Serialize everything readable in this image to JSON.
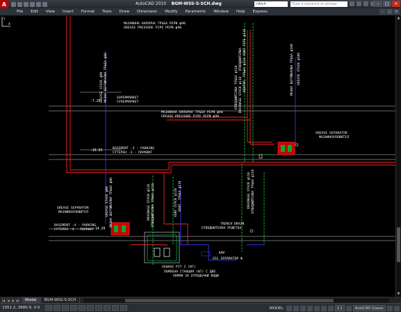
{
  "titlebar": {
    "app_letter": "A",
    "app_name": "AutoCAD 2010",
    "file_name": "BGM-WSS-S-SCH.dwg",
    "search_placeholder": "Type a keyword or phrase",
    "workspace_field": "r-Arch",
    "minimize": "–",
    "maximize": "□",
    "close": "×"
  },
  "menubar": {
    "items": [
      "File",
      "Edit",
      "View",
      "Insert",
      "Format",
      "Tools",
      "Draw",
      "Dimension",
      "Modify",
      "Parametric",
      "Window",
      "Help",
      "Express"
    ],
    "doc_minimize": "–",
    "doc_restore": "□",
    "doc_close": "×"
  },
  "drawing": {
    "labels": {
      "pipe_bg_top": "МАЗНИННА НАПОРНА ТРЪБА PEPN ф90",
      "pipe_en_top": "GREASE PRESSURE PIPE PEPN ф90",
      "pipe_bg_mid": "МАЗНИННА НАПОРНА ТРЪБА PEPN ф90",
      "pipe_en_mid": "GREASE PRESSURE PIPE PEPN ф90",
      "level_1": "-7.20",
      "supermarket_en": "SUPERMARKET",
      "supermarket_bg": "СУПЕРМАРКЕТ",
      "level_2": "-10.95",
      "basement3_en": "BASEMENT -3 - PARKING",
      "basement3_bg": "СУТЕРЕН -3 - ПАРКИНГ",
      "level_3": "-14.20",
      "basement4_en": "BASEMENT -4 - PARKING",
      "basement4_bg": "СУТЕРЕН -4 - ПАРКИНГ",
      "grease_sep_right_en": "GREASE SEPARATOR",
      "grease_sep_right_bg": "МАЗНИНОУЛОВИТЕЛ",
      "grease_sep_left_en": "GREASE SEPARATOR",
      "grease_sep_left_bg": "МАЗНИНОУЛОВИТЕЛ",
      "trench_en": "TRENCH DRAIN",
      "trench_bg": "ОТВОДНИТЕЛНА РЕШЕТКА",
      "kmv": "КМУ",
      "oil_sep": "OIL SEPARATOR №",
      "sewage_pit_en": "SEWAGE PIT 2 (N7)",
      "sewage_pit_bg1": "ПОМПЕНА СТАНЦИЯ (N7) С ДВЕ",
      "sewage_pit_bg2": "ПОМПИ ЗА ОТПАДЪЧНИ ВОДИ",
      "v_grease_stack_left_en": "GREASE STACK ф90",
      "v_grease_stack_left_bg": "МАЗНА ВЕРТИКАЛНА ТРЪБА ф90",
      "v_grease_stack_right_bg": "МАЗНА ВЕРТИКАЛНА ТРЪБА ф100",
      "v_grease_stack_right_en": "GREASE STACK ф100",
      "v_grease_stack_low_en": "GREASE STACK ф90",
      "v_grease_stack_low_bg": "МАЗНА ВЕРТИКАЛНА ТРЪБА ф90",
      "v_drainage_top1": "ОТВОДНИТЕЛНА ТРЪБА ф110",
      "v_drainage_top2": "DRAINAGE STACK ф110 - ОТВОДНИТЕЛНА",
      "v_drainage_top3": "ВЕНТИЛ. ТРЪБА ф110 VENT PIPE ф110",
      "v_drainage_mid1": "DRAINAGE STACK ф110",
      "v_drainage_mid2": "ОТВОДНИТЕЛНА ТРЪБА ф110",
      "v_drainage_low1": "DRAINAGE STACK ф110",
      "v_drainage_low2": "ОТВОДНИТЕЛНА ТРЪБА ф110",
      "v_vent_low1": "VENT STACK ф110",
      "v_vent_low2": "ВЕНТ. ТРЪБА ф110",
      "v_drainage_right1": "DRAINAGE STACK ф110",
      "v_drainage_right2": "ОТВОДНИТЕЛНА ТРЪБА ф110"
    }
  },
  "tabs": {
    "items": [
      "Model",
      "BGM-WSS-S-SCH"
    ],
    "first": "|◀",
    "prev": "◀",
    "next": "▶",
    "last": "▶|"
  },
  "statusbar": {
    "coordinates": "1951.2, 3880.9, 0.0",
    "model_label": "MODEL",
    "annotation_scale": "1:1",
    "workspace": "AutoCAD Classic"
  },
  "colors": {
    "background": "#000000",
    "red_pipe": "#ff2020",
    "blue_pipe": "#3333ff",
    "green": "#00cc33",
    "white": "#ffffff",
    "gray": "#8a8a8a"
  }
}
